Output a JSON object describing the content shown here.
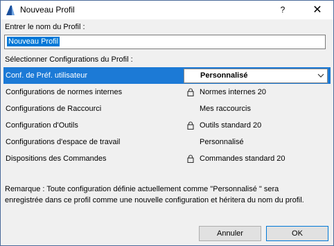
{
  "window": {
    "title": "Nouveau Profil",
    "help_glyph": "?",
    "close_glyph": "✕"
  },
  "name_section": {
    "label": "Entrer le nom du Profil :",
    "value": "Nouveau Profil"
  },
  "configs_section": {
    "label": "Sélectionner Configurations du Profil :",
    "rows": [
      {
        "name": "Conf. de Préf. utilisateur",
        "value": "Personnalisé",
        "locked": false,
        "selected": true
      },
      {
        "name": "Configurations de normes internes",
        "value": "Normes internes 20",
        "locked": true,
        "selected": false
      },
      {
        "name": "Configurations de Raccourci",
        "value": "Mes raccourcis",
        "locked": false,
        "selected": false
      },
      {
        "name": "Configuration d'Outils",
        "value": "Outils standard 20",
        "locked": true,
        "selected": false
      },
      {
        "name": "Configurations d'espace de travail",
        "value": "Personnalisé",
        "locked": false,
        "selected": false
      },
      {
        "name": "Dispositions des Commandes",
        "value": "Commandes standard 20",
        "locked": true,
        "selected": false
      }
    ]
  },
  "remark": {
    "line1": "Remarque : Toute configuration définie actuellement comme \"Personnalisé \" sera",
    "line2": "enregistrée dans ce profil comme une nouvelle configuration et héritera du nom du profil."
  },
  "buttons": {
    "cancel": "Annuler",
    "ok": "OK"
  },
  "colors": {
    "selection": "#1c7ad6",
    "text_selection": "#0078d7"
  },
  "icons": {
    "app": "archicad-icon",
    "lock": "lock-icon",
    "dropdown": "chevron-down-icon"
  }
}
